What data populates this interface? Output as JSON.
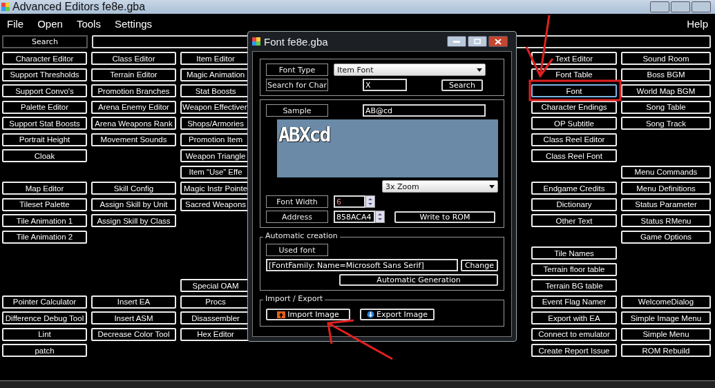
{
  "window": {
    "title": "Advanced Editors fe8e.gba"
  },
  "menu": [
    {
      "label": "File"
    },
    {
      "label": "Open"
    },
    {
      "label": "Tools"
    },
    {
      "label": "Settings"
    }
  ],
  "right_menu": [
    {
      "label": "Help"
    }
  ],
  "search": {
    "button": "Search"
  },
  "columns": [
    {
      "items": [
        {
          "kind": "button",
          "label": "Character Editor"
        },
        {
          "kind": "button",
          "label": "Support Thresholds"
        },
        {
          "kind": "button",
          "label": "Support Convo's"
        },
        {
          "kind": "button",
          "label": "Palette Editor"
        },
        {
          "kind": "button",
          "label": "Support Stat Boosts"
        },
        {
          "kind": "button",
          "label": "Portrait Height"
        },
        {
          "kind": "button",
          "label": "Cloak"
        },
        {
          "kind": "gap"
        },
        {
          "kind": "button",
          "label": "Map Editor"
        },
        {
          "kind": "button",
          "label": "Tileset Palette"
        },
        {
          "kind": "button",
          "label": "Tile Animation 1"
        },
        {
          "kind": "button",
          "label": "Tile Animation 2"
        },
        {
          "kind": "gap"
        },
        {
          "kind": "gap"
        },
        {
          "kind": "gap"
        },
        {
          "kind": "button",
          "label": "Pointer Calculator"
        },
        {
          "kind": "button",
          "label": "Difference Debug Tool"
        },
        {
          "kind": "button",
          "label": "Lint"
        },
        {
          "kind": "button",
          "label": "patch"
        }
      ]
    },
    {
      "items": [
        {
          "kind": "button",
          "label": "Class Editor"
        },
        {
          "kind": "button",
          "label": "Terrain Editor"
        },
        {
          "kind": "button",
          "label": "Promotion Branches"
        },
        {
          "kind": "button",
          "label": "Arena Enemy Editor"
        },
        {
          "kind": "button",
          "label": "Arena Weapons Rank"
        },
        {
          "kind": "button",
          "label": "Movement Sounds"
        },
        {
          "kind": "gap"
        },
        {
          "kind": "gap"
        },
        {
          "kind": "button",
          "label": "Skill Config"
        },
        {
          "kind": "button",
          "label": "Assign Skill by Unit"
        },
        {
          "kind": "button",
          "label": "Assign Skill by Class"
        },
        {
          "kind": "gap"
        },
        {
          "kind": "gap"
        },
        {
          "kind": "gap"
        },
        {
          "kind": "gap"
        },
        {
          "kind": "button",
          "label": "Insert EA"
        },
        {
          "kind": "button",
          "label": "Insert ASM"
        },
        {
          "kind": "button",
          "label": "Decrease Color Tool"
        }
      ]
    },
    {
      "items": [
        {
          "kind": "button",
          "label": "Item Editor"
        },
        {
          "kind": "button",
          "label": "Magic Animation"
        },
        {
          "kind": "button",
          "label": "Stat Boosts"
        },
        {
          "kind": "button",
          "label": "Weapon Effectiven"
        },
        {
          "kind": "button",
          "label": "Shops/Armories"
        },
        {
          "kind": "button",
          "label": "Promotion Item"
        },
        {
          "kind": "button",
          "label": "Weapon Triangle"
        },
        {
          "kind": "button",
          "label": "Item “Use” Effe"
        },
        {
          "kind": "button",
          "label": "Magic Instr Pointe"
        },
        {
          "kind": "button",
          "label": "Sacred Weapons"
        },
        {
          "kind": "gap"
        },
        {
          "kind": "gap"
        },
        {
          "kind": "gap"
        },
        {
          "kind": "gap"
        },
        {
          "kind": "button",
          "label": "Special OAM"
        },
        {
          "kind": "button",
          "label": "Procs"
        },
        {
          "kind": "button",
          "label": "Disassembler"
        },
        {
          "kind": "button",
          "label": "Hex Editor"
        }
      ]
    },
    {
      "items": [
        {
          "kind": "button",
          "label": "Text Editor"
        },
        {
          "kind": "button",
          "label": "Font Table"
        },
        {
          "kind": "button",
          "label": "Font",
          "selected": true
        },
        {
          "kind": "button",
          "label": "Character Endings"
        },
        {
          "kind": "button",
          "label": "OP Subtitle"
        },
        {
          "kind": "button",
          "label": "Class Reel Editor"
        },
        {
          "kind": "button",
          "label": "Class Reel Font"
        },
        {
          "kind": "gap"
        },
        {
          "kind": "button",
          "label": "Endgame Credits"
        },
        {
          "kind": "button",
          "label": "Dictionary"
        },
        {
          "kind": "button",
          "label": "Other Text"
        },
        {
          "kind": "gap"
        },
        {
          "kind": "button",
          "label": "Tile Names"
        },
        {
          "kind": "button",
          "label": "Terrain floor table"
        },
        {
          "kind": "button",
          "label": "Terrain BG table"
        },
        {
          "kind": "button",
          "label": "Event Flag Namer"
        },
        {
          "kind": "button",
          "label": "Export with EA"
        },
        {
          "kind": "button",
          "label": "Connect to emulator"
        },
        {
          "kind": "button",
          "label": "Create Report Issue"
        }
      ]
    },
    {
      "items": [
        {
          "kind": "button",
          "label": "Sound Room"
        },
        {
          "kind": "button",
          "label": "Boss BGM"
        },
        {
          "kind": "button",
          "label": "World Map BGM"
        },
        {
          "kind": "button",
          "label": "Song Table"
        },
        {
          "kind": "button",
          "label": "Song Track"
        },
        {
          "kind": "gap"
        },
        {
          "kind": "gap"
        },
        {
          "kind": "button",
          "label": "Menu Commands"
        },
        {
          "kind": "button",
          "label": "Menu Definitions"
        },
        {
          "kind": "button",
          "label": "Status Parameter"
        },
        {
          "kind": "button",
          "label": "Status RMenu"
        },
        {
          "kind": "button",
          "label": "Game Options"
        },
        {
          "kind": "gap"
        },
        {
          "kind": "gap"
        },
        {
          "kind": "gap"
        },
        {
          "kind": "button",
          "label": "WelcomeDialog"
        },
        {
          "kind": "button",
          "label": "Simple Image Menu"
        },
        {
          "kind": "button",
          "label": "Simple Menu"
        },
        {
          "kind": "button",
          "label": "ROM Rebuild"
        }
      ]
    }
  ],
  "dialog": {
    "title": "Font fe8e.gba",
    "font_type": {
      "label": "Font Type",
      "value": "Item Font"
    },
    "search_char": {
      "label": "Search for Char",
      "value": "X",
      "button": "Search"
    },
    "sample": {
      "label": "Sample",
      "value": "AB@cd",
      "preview": "ABXcd"
    },
    "zoom": {
      "value": "3x Zoom"
    },
    "font_width": {
      "label": "Font Width",
      "value": "6"
    },
    "address": {
      "label": "Address",
      "value": "858ACA4",
      "button": "Write to ROM"
    },
    "automatic": {
      "legend": "Automatic creation",
      "label": "Used font",
      "value": "[FontFamily: Name=Microsoft Sans Serif]",
      "change": "Change",
      "generate": "Automatic Generation"
    },
    "import_export": {
      "legend": "Import / Export",
      "import": "Import Image",
      "export": "Export Image"
    }
  }
}
